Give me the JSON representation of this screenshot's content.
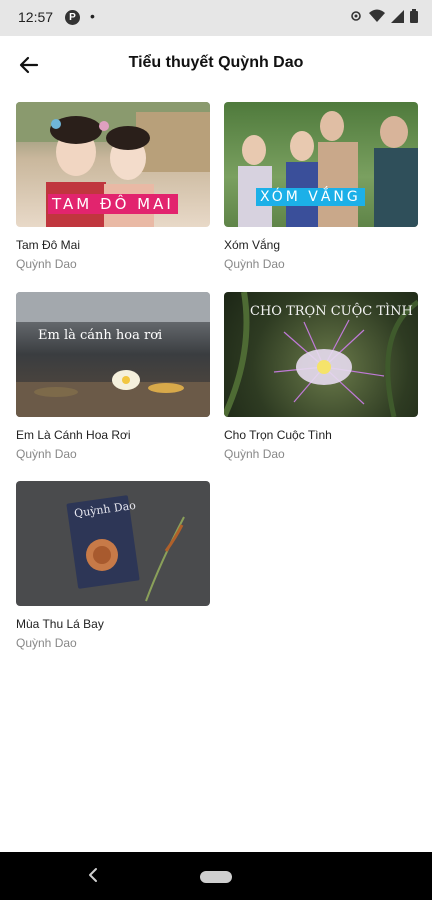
{
  "status": {
    "time": "12:57",
    "app_icon_letter": "P",
    "dot": "•"
  },
  "header": {
    "title": "Tiểu thuyết Quỳnh Dao",
    "back_icon": "arrow-left-icon"
  },
  "books": [
    {
      "title": "Tam Đô Mai",
      "author": "Quỳnh Dao",
      "cover_text": "TAM ĐÔ MAI"
    },
    {
      "title": "Xóm Vắng",
      "author": "Quỳnh Dao",
      "cover_text": "XÓM VẮNG"
    },
    {
      "title": "Em Là Cánh Hoa Rơi",
      "author": "Quỳnh Dao",
      "cover_text": "Em là cánh hoa rơi"
    },
    {
      "title": "Cho Trọn Cuộc Tình",
      "author": "Quỳnh Dao",
      "cover_text": "CHO TRỌN CUỘC TÌNH"
    },
    {
      "title": "Mùa Thu Lá Bay",
      "author": "Quỳnh Dao",
      "cover_text": "Quỳnh Dao"
    }
  ]
}
